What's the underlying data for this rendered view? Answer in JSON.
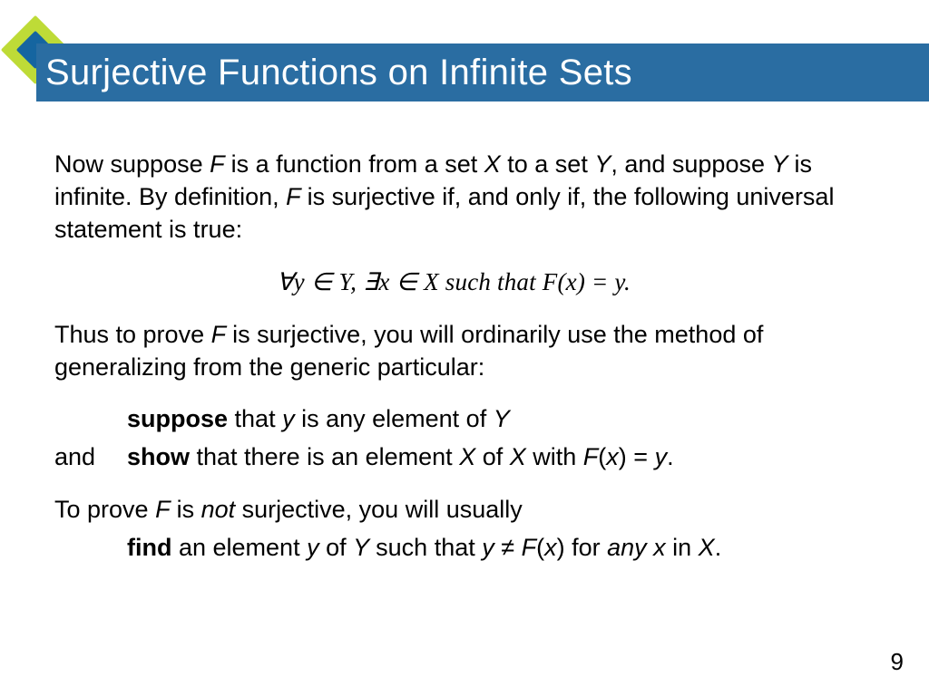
{
  "title": "Surjective Functions on Infinite Sets",
  "intro": {
    "t1": "Now suppose ",
    "F1": "F ",
    "t2": "is a function from a set ",
    "X1": "X ",
    "t3": "to a set ",
    "Y1": "Y",
    "t4": ", and suppose ",
    "Y2": "Y ",
    "t5": "is infinite. By definition, ",
    "F2": "F ",
    "t6": "is surjective if, and only if, the following universal statement is true:"
  },
  "formula": "∀y ∈ Y, ∃x ∈ X such that F(x) = y.",
  "thus": {
    "t1": "Thus to prove ",
    "F": "F ",
    "t2": "is surjective, you will ordinarily use the method of generalizing from the generic particular:"
  },
  "suppose": {
    "kw": "suppose",
    "t1": " that ",
    "y": "y ",
    "t2": "is any element of ",
    "Y": "Y"
  },
  "and_label": "and",
  "show": {
    "kw": "show",
    "t1": " that there is an element ",
    "X1": "X ",
    "t2": "of ",
    "X2": "X ",
    "t3": "with ",
    "F": "F",
    "lp": "(",
    "x": "x",
    "rp": ") ",
    "eq": "= ",
    "y": "y",
    "dot": "."
  },
  "neg_intro": {
    "t1": "To prove ",
    "F": "F ",
    "t2": "is ",
    "not": "not ",
    "t3": "surjective, you will usually"
  },
  "find": {
    "kw": "find",
    "t1": " an element ",
    "y1": "y ",
    "t2": "of ",
    "Y": "Y ",
    "t3": "such that ",
    "y2": "y ",
    "neq": "≠ ",
    "F": "F",
    "lp": "(",
    "x1": "x",
    "rp": ") ",
    "t4": "for ",
    "any": "any ",
    "x2": "x",
    "t5": " in ",
    "X": "X",
    "dot": "."
  },
  "page_number": "9"
}
